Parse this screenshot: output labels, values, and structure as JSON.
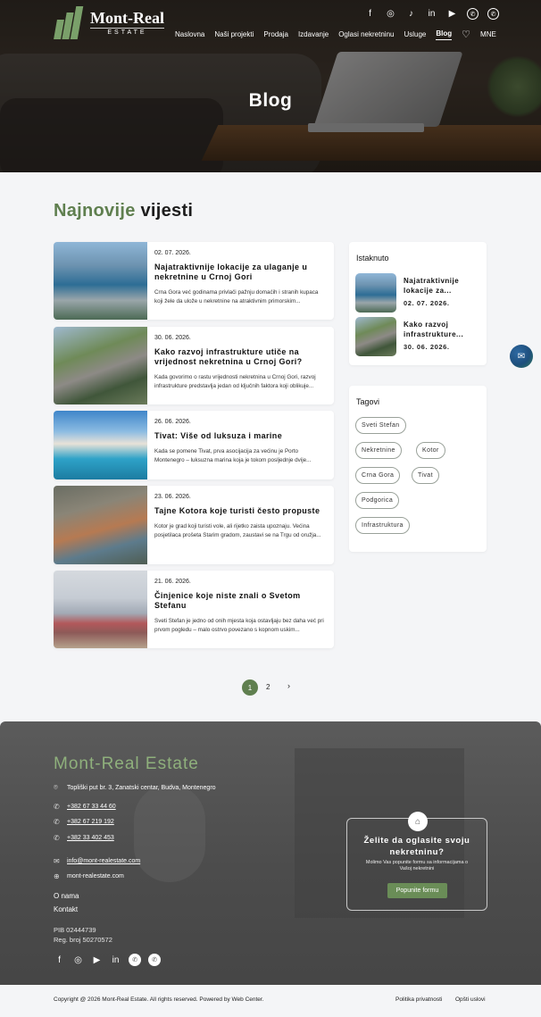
{
  "header": {
    "logo_main": "Mont-Real",
    "logo_sub": "ESTATE",
    "nav": [
      "Naslovna",
      "Naši projekti",
      "Prodaja",
      "Izdavanje",
      "Oglasi nekretninu",
      "Usluge",
      "Blog"
    ],
    "lang": "MNE",
    "socials": [
      "f",
      "◎",
      "♪",
      "in",
      "▶",
      "✆",
      "✆"
    ]
  },
  "hero": {
    "title": "Blog"
  },
  "section": {
    "title_green": "Najnovije",
    "title_dark": "vijesti"
  },
  "posts": [
    {
      "date": "02. 07. 2026.",
      "title": "Najatraktivnije lokacije za ulaganje u nekretnine u Crnoj Gori",
      "excerpt": "Crna Gora već godinama privlači pažnju domaćih i stranih kupaca koji žele da ulože u nekretnine na atraktivnim primorskim..."
    },
    {
      "date": "30. 06. 2026.",
      "title": "Kako razvoj infrastrukture utiče na vrijednost nekretnina u Crnoj Gori?",
      "excerpt": "Kada govorimo o rastu vrijednosti nekretnina u Crnoj Gori, razvoj infrastrukture predstavlja jedan od ključnih faktora koji oblikuje..."
    },
    {
      "date": "26. 06. 2026.",
      "title": "Tivat: Više od luksuza i marine",
      "excerpt": "Kada se pomene Tivat, prva asocijacija za većinu je Porto Montenegro – luksuzna marina koja je tokom posljednje dvije..."
    },
    {
      "date": "23. 06. 2026.",
      "title": "Tajne Kotora koje turisti često propuste",
      "excerpt": "Kotor je grad koji turisti vole, ali rijetko zaista upoznaju. Većina posjetilaca prošeta Starim gradom, zaustavi se na Trgu od oružja..."
    },
    {
      "date": "21. 06. 2026.",
      "title": "Činjenice koje niste znali o Svetom Stefanu",
      "excerpt": "Sveti Stefan je jedno od onih mjesta koja ostavljaju bez daha već pri prvom pogledu – malo ostrvo povezano s kopnom uskim..."
    }
  ],
  "sidebar": {
    "featured_title": "Istaknuto",
    "featured": [
      {
        "title": "Najatraktivnije lokacije za...",
        "date": "02. 07. 2026."
      },
      {
        "title": "Kako razvoj infrastrukture...",
        "date": "30. 06. 2026."
      }
    ],
    "tags_title": "Tagovi",
    "tags": [
      "Sveti Stefan",
      "Nekretnine",
      "Kotor",
      "Crna Gora",
      "Tivat",
      "Podgorica",
      "Infrastruktura"
    ]
  },
  "pagination": {
    "current": "1",
    "next_page": "2",
    "next": "›"
  },
  "footer": {
    "brand": "Mont-Real Estate",
    "address": "Topliški put br. 3, Zanatski centar, Budva, Montenegro",
    "phones": [
      "+382 67 33 44 60",
      "+382 67 219 192",
      "+382 33 402 453"
    ],
    "email": "info@mont-realestate.com",
    "website": "mont-realestate.com",
    "links": [
      "O nama",
      "Kontakt"
    ],
    "pib": "PIB 02444739",
    "reg": "Reg. broj 50270572",
    "cta_title": "Želite da oglasite svoju nekretninu?",
    "cta_desc": "Molimo Vas popunite formu sa informacijama o Vašoj nekretnini",
    "cta_button": "Popunite formu",
    "copyright": "Copyright @ 2026 Mont-Real Estate. All rights reserved. Powered by Web Center.",
    "privacy": "Politika privatnosti",
    "terms": "Opšti uslovi"
  },
  "colors": {
    "accent": "#5f7f4f",
    "footer_bg": "#4c4c4c"
  }
}
